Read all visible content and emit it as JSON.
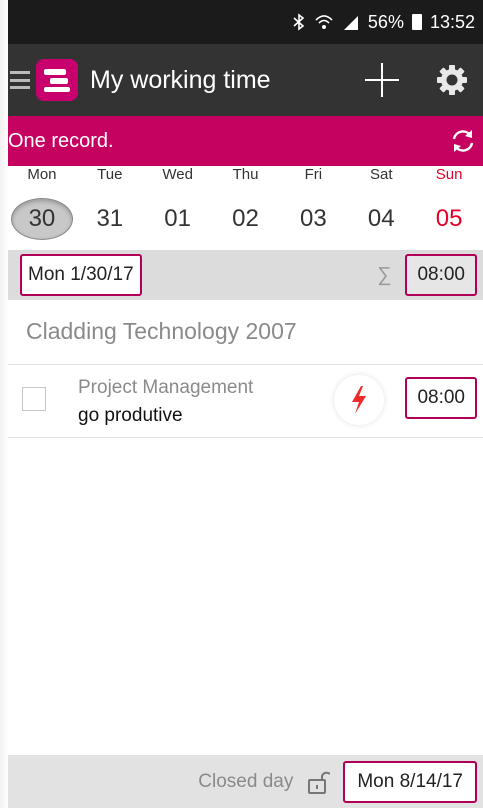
{
  "status_bar": {
    "bluetooth_icon": "bluetooth-icon",
    "wifi_icon": "wifi-icon",
    "signal_icon": "signal-icon",
    "battery": "56%",
    "time": "13:52"
  },
  "app_bar": {
    "title": "My working time",
    "logo_color": "#c7006e",
    "add_icon": "plus-icon",
    "settings_icon": "gear-icon"
  },
  "record_bar": {
    "text": "One record.",
    "color": "#c5025f",
    "refresh_icon": "refresh-icon"
  },
  "week": {
    "days": [
      "Mon",
      "Tue",
      "Wed",
      "Thu",
      "Fri",
      "Sat",
      "Sun"
    ],
    "dates": [
      "30",
      "31",
      "01",
      "02",
      "03",
      "04",
      "05"
    ],
    "selected": "30",
    "weekend_color": "#e5002a"
  },
  "day_header": {
    "date": "Mon 1/30/17",
    "sum_symbol": "∑",
    "total": "08:00"
  },
  "project": {
    "name": "Cladding Technology 2007"
  },
  "entries": [
    {
      "task": "Project Management",
      "description": "go produtive",
      "icon": "lightning-icon",
      "duration": "08:00"
    }
  ],
  "footer": {
    "label": "Closed day",
    "lock_icon": "lock-icon",
    "date": "Mon 8/14/17"
  },
  "accent_color": "#b00057"
}
